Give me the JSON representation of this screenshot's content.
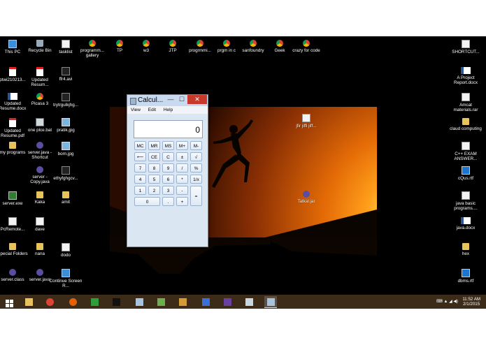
{
  "desktop_icons": [
    {
      "label": "This PC",
      "icon": "computer-icon",
      "cls": "g-pc"
    },
    {
      "label": "Recycle Bin",
      "icon": "recycle-bin-icon",
      "cls": "g-bin"
    },
    {
      "label": "tasklist",
      "icon": "document-icon",
      "cls": "g-doc"
    },
    {
      "label": "programm... gallery",
      "icon": "chrome-shortcut-icon",
      "cls": "g-chrome"
    },
    {
      "label": "TP",
      "icon": "chrome-shortcut-icon",
      "cls": "g-chrome"
    },
    {
      "label": "w3",
      "icon": "chrome-shortcut-icon",
      "cls": "g-chrome"
    },
    {
      "label": "JTP",
      "icon": "chrome-shortcut-icon",
      "cls": "g-chrome"
    },
    {
      "label": "progrmmi...",
      "icon": "chrome-shortcut-icon",
      "cls": "g-chrome"
    },
    {
      "label": "prgm in c",
      "icon": "chrome-shortcut-icon",
      "cls": "g-chrome"
    },
    {
      "label": "sanfoundry",
      "icon": "chrome-shortcut-icon",
      "cls": "g-chrome"
    },
    {
      "label": "Geek",
      "icon": "chrome-shortcut-icon",
      "cls": "g-chrome"
    },
    {
      "label": "crazy for code",
      "icon": "chrome-shortcut-icon",
      "cls": "g-chrome"
    },
    {
      "label": "SHORTCUT...",
      "icon": "document-icon",
      "cls": "g-doc"
    },
    {
      "label": "ptwi210213...",
      "icon": "pdf-icon",
      "cls": "g-pdf"
    },
    {
      "label": "Updated Resum...",
      "icon": "pdf-icon",
      "cls": "g-pdf"
    },
    {
      "label": "ffr4.avi",
      "icon": "video-icon",
      "cls": "g-video"
    },
    {
      "label": "A Project Report.docx",
      "icon": "word-icon",
      "cls": "g-word"
    },
    {
      "label": "Updated Resume.docx",
      "icon": "word-icon",
      "cls": "g-word"
    },
    {
      "label": "Picasa 3",
      "icon": "picasa-icon",
      "cls": "g-chrome"
    },
    {
      "label": "trytrgulkjhg...",
      "icon": "video-icon",
      "cls": "g-video"
    },
    {
      "label": "Amcat materials.rar",
      "icon": "archive-icon",
      "cls": "g-doc"
    },
    {
      "label": "Updated Resume.pdf",
      "icon": "pdf-icon",
      "cls": "g-pdf"
    },
    {
      "label": "one plce.bat",
      "icon": "batch-file-icon",
      "cls": "g-bat"
    },
    {
      "label": "pratik.jpg",
      "icon": "image-icon",
      "cls": "g-img"
    },
    {
      "label": "claud computing",
      "icon": "folder-icon",
      "cls": "g-folder"
    },
    {
      "label": "my programs",
      "icon": "folder-icon",
      "cls": "g-folder"
    },
    {
      "label": "server.java - Shortcut",
      "icon": "java-icon",
      "cls": "g-java"
    },
    {
      "label": "born.jpg",
      "icon": "image-icon",
      "cls": "g-img"
    },
    {
      "label": "C++ EXAM ANSWER...",
      "icon": "document-icon",
      "cls": "g-doc"
    },
    {
      "label": "server - Copy.java",
      "icon": "java-icon",
      "cls": "g-java"
    },
    {
      "label": "ethyfghgcv...",
      "icon": "video-icon",
      "cls": "g-video"
    },
    {
      "label": "cQus.rtf",
      "icon": "rtf-icon",
      "cls": "g-rtf"
    },
    {
      "label": "server.exe",
      "icon": "exe-icon",
      "cls": "g-exe"
    },
    {
      "label": "Kaka",
      "icon": "folder-icon",
      "cls": "g-folder"
    },
    {
      "label": "amit",
      "icon": "folder-icon",
      "cls": "g-folder"
    },
    {
      "label": "java basic programs....",
      "icon": "document-icon",
      "cls": "g-doc"
    },
    {
      "label": "PcRemote...",
      "icon": "document-icon",
      "cls": "g-doc"
    },
    {
      "label": "dave",
      "icon": "document-icon",
      "cls": "g-doc"
    },
    {
      "label": "java.docx",
      "icon": "word-icon",
      "cls": "g-word"
    },
    {
      "label": "Special Folders",
      "icon": "folder-icon",
      "cls": "g-folder"
    },
    {
      "label": "nana",
      "icon": "folder-icon",
      "cls": "g-folder"
    },
    {
      "label": "dodo",
      "icon": "document-icon",
      "cls": "g-doc"
    },
    {
      "label": "hex",
      "icon": "folder-icon",
      "cls": "g-folder"
    },
    {
      "label": "server.class",
      "icon": "class-file-icon",
      "cls": "g-java"
    },
    {
      "label": "server.java",
      "icon": "java-icon",
      "cls": "g-java"
    },
    {
      "label": "Continue Screen R...",
      "icon": "app-icon",
      "cls": "g-pc"
    },
    {
      "label": "dbms.rtf",
      "icon": "rtf-icon",
      "cls": "g-rtf"
    },
    {
      "label": "jfir jiffi jiff...",
      "icon": "document-icon",
      "cls": "g-doc"
    },
    {
      "label": "Tatkal.jar",
      "icon": "java-icon",
      "cls": "g-java"
    }
  ],
  "calculator": {
    "title": "Calcul...",
    "minimize": "—",
    "maximize": "☐",
    "close": "✕",
    "menu": [
      "View",
      "Edit",
      "Help"
    ],
    "display": "0",
    "buttons": [
      "MC",
      "MR",
      "MS",
      "M+",
      "M-",
      "⟵",
      "CE",
      "C",
      "±",
      "√",
      "7",
      "8",
      "9",
      "/",
      "%",
      "4",
      "5",
      "6",
      "*",
      "1/x",
      "1",
      "2",
      "3",
      "-",
      "=",
      "0",
      ".",
      "+"
    ]
  },
  "taskbar": {
    "apps": [
      {
        "name": "start-button",
        "color": "#ffffff"
      },
      {
        "name": "file-explorer-icon",
        "color": "#e8c25a"
      },
      {
        "name": "chrome-icon",
        "color": "#db4437"
      },
      {
        "name": "firefox-icon",
        "color": "#e66000"
      },
      {
        "name": "store-icon",
        "color": "#2e9e3a"
      },
      {
        "name": "cmd-icon",
        "color": "#111111"
      },
      {
        "name": "notepad-icon",
        "color": "#a9c3dc"
      },
      {
        "name": "image-viewer-icon",
        "color": "#6ab04c"
      },
      {
        "name": "word-icon",
        "color": "#d59b35"
      },
      {
        "name": "dev-tool-icon",
        "color": "#3a6fd8"
      },
      {
        "name": "visual-studio-icon",
        "color": "#6a3fa0"
      },
      {
        "name": "remote-desktop-icon",
        "color": "#c9d6e4"
      },
      {
        "name": "calculator-icon",
        "color": "#a9c3dc"
      }
    ],
    "time": "11:52 AM",
    "date": "2/1/2015"
  }
}
